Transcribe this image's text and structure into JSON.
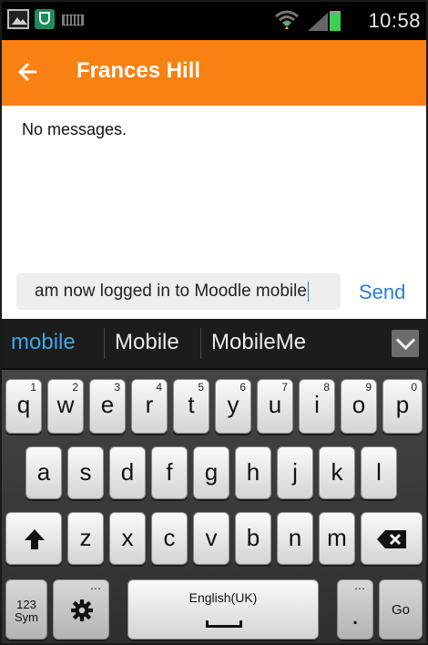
{
  "status_bar": {
    "time": "10:58"
  },
  "header": {
    "title": "Frances Hill"
  },
  "messages": {
    "empty_text": "No messages."
  },
  "compose": {
    "input_value": "am now logged in to Moodle mobile",
    "send_label": "Send"
  },
  "suggestions": [
    "mobile",
    "Mobile",
    "MobileMe"
  ],
  "keyboard": {
    "row1": [
      {
        "label": "q",
        "sup": "1"
      },
      {
        "label": "w",
        "sup": "2"
      },
      {
        "label": "e",
        "sup": "3"
      },
      {
        "label": "r",
        "sup": "4"
      },
      {
        "label": "t",
        "sup": "5"
      },
      {
        "label": "y",
        "sup": "6"
      },
      {
        "label": "u",
        "sup": "7"
      },
      {
        "label": "i",
        "sup": "8"
      },
      {
        "label": "o",
        "sup": "9"
      },
      {
        "label": "p",
        "sup": "0"
      }
    ],
    "row2": [
      "a",
      "s",
      "d",
      "f",
      "g",
      "h",
      "j",
      "k",
      "l"
    ],
    "row3": [
      "z",
      "x",
      "c",
      "v",
      "b",
      "n",
      "m"
    ],
    "sym_label_1": "123",
    "sym_label_2": "Sym",
    "space_label": "English(UK)",
    "period_label": ".",
    "go_label": "Go"
  },
  "colors": {
    "header": "#f98012",
    "send": "#2f7bd0",
    "suggestion_primary": "#3ea7e8"
  }
}
